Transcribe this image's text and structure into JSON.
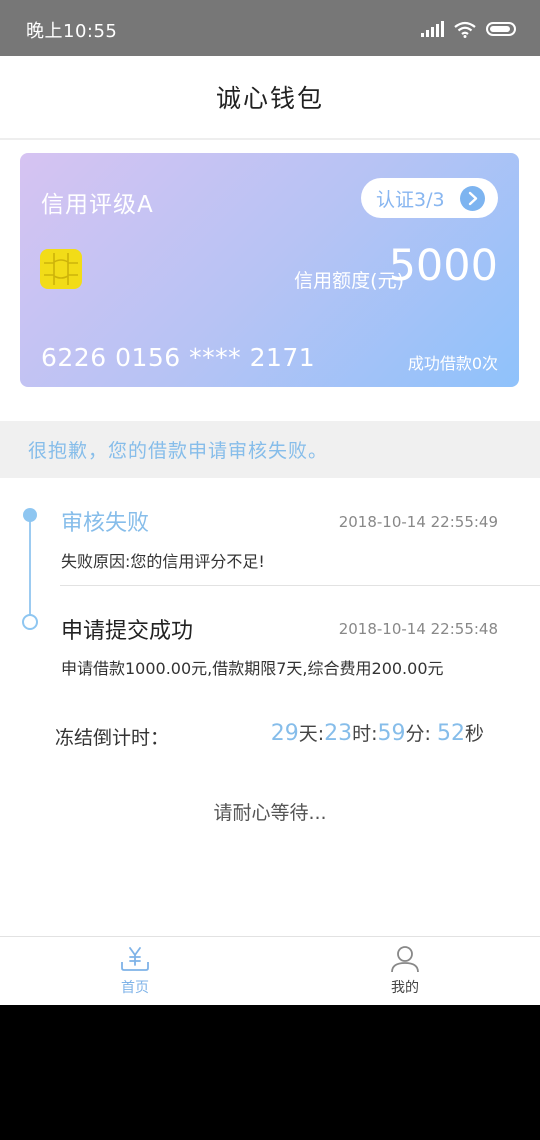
{
  "status_bar": {
    "time": "晚上10:55"
  },
  "header": {
    "title": "诚心钱包"
  },
  "card": {
    "rating": "信用评级A",
    "verify_label": "认证3/3",
    "limit_label": "信用额度(元)",
    "limit_value": "5000",
    "card_number": "6226 0156 **** 2171",
    "borrow_count": "成功借款0次"
  },
  "notice": {
    "text": "很抱歉，您的借款申请审核失败。"
  },
  "timeline": [
    {
      "title": "审核失败",
      "time": "2018-10-14 22:55:49",
      "desc": "失败原因:您的信用评分不足!"
    },
    {
      "title": "申请提交成功",
      "time": "2018-10-14 22:55:48",
      "desc": "申请借款1000.00元,借款期限7天,综合费用200.00元"
    }
  ],
  "countdown": {
    "label": "冻结倒计时：",
    "days": "29",
    "days_unit": "天:",
    "hours": "23",
    "hours_unit": "时:",
    "minutes": "59",
    "minutes_unit": "分:",
    "seconds": "52",
    "seconds_unit": "秒"
  },
  "wait_text": "请耐心等待...",
  "tabbar": {
    "home": {
      "label": "首页",
      "icon": "yen-icon"
    },
    "me": {
      "label": "我的",
      "icon": "user-icon"
    }
  },
  "colors": {
    "accent": "#86bdea",
    "status_bar": "#777777",
    "chip": "#f2dc18"
  }
}
